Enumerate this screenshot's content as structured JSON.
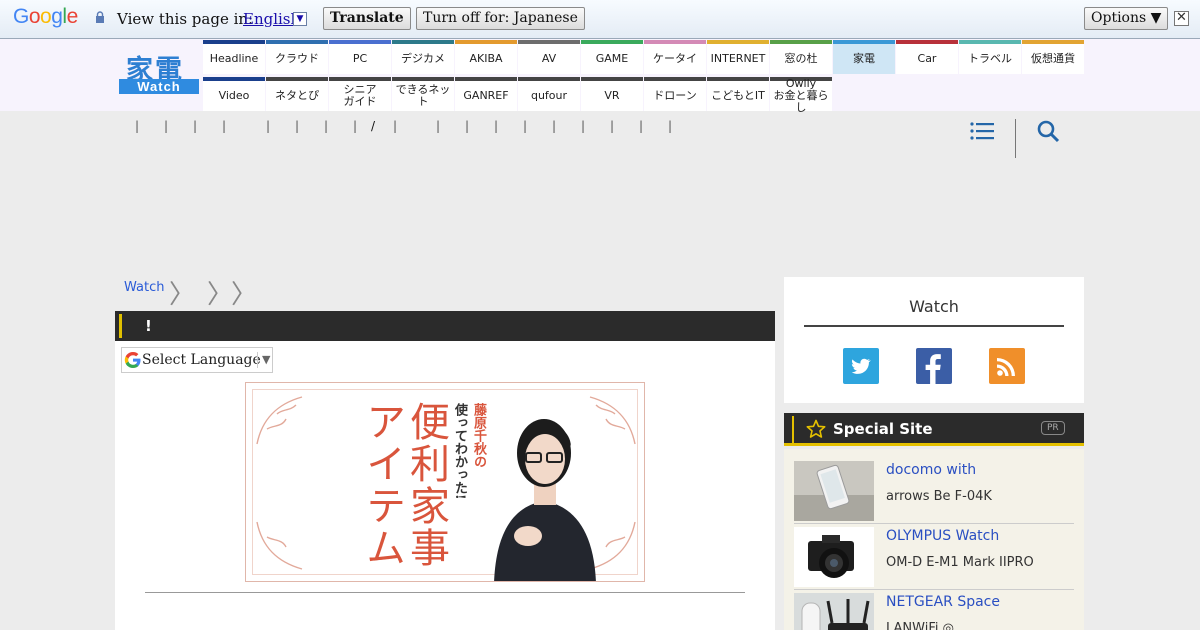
{
  "translate_bar": {
    "logo": "Google",
    "prompt": "View this page in:",
    "language": "English",
    "translate_label": "Translate",
    "turn_off_label": "Turn off for: Japanese",
    "options_label": "Options ▼",
    "close_label": "✕"
  },
  "site": {
    "logo_kanji": "家電",
    "logo_text": "Watch"
  },
  "nav": {
    "row1": [
      {
        "label": "Headline",
        "color": "#1a3f8c"
      },
      {
        "label": "クラウド",
        "color": "#2f6fb0"
      },
      {
        "label": "PC",
        "color": "#4a6fd0"
      },
      {
        "label": "デジカメ",
        "color": "#2d7a8a"
      },
      {
        "label": "AKIBA",
        "color": "#e39a2e"
      },
      {
        "label": "AV",
        "color": "#6d6d6d"
      },
      {
        "label": "GAME",
        "color": "#3aaa5c"
      },
      {
        "label": "ケータイ",
        "color": "#d48ab6"
      },
      {
        "label": "INTERNET",
        "color": "#e0b030"
      },
      {
        "label": "窓の杜",
        "color": "#58a048"
      },
      {
        "label": "家電",
        "color": "#3a98d6"
      },
      {
        "label": "Car",
        "color": "#b8313a"
      },
      {
        "label": "トラベル",
        "color": "#59b8b0"
      },
      {
        "label": "仮想通貨",
        "color": "#e2a432"
      }
    ],
    "row2": [
      {
        "label": "Video",
        "color": "#1a3f8c"
      },
      {
        "label": "ネタとぴ",
        "color": "#444444"
      },
      {
        "label": "シニア\nガイド",
        "color": "#444444"
      },
      {
        "label": "できるネット",
        "color": "#444444"
      },
      {
        "label": "GANREF",
        "color": "#444444"
      },
      {
        "label": "qufour",
        "color": "#444444"
      },
      {
        "label": "VR",
        "color": "#444444"
      },
      {
        "label": "ドローン",
        "color": "#444444"
      },
      {
        "label": "こどもとIT",
        "color": "#444444"
      },
      {
        "label": "Owlly\nお金と暮らし",
        "color": "#444444"
      }
    ]
  },
  "subnav": {
    "separators": [
      "|",
      "|",
      "|",
      "|",
      "|",
      "|",
      "|",
      "|",
      "/",
      "|",
      "|",
      "|",
      "|",
      "|",
      "|",
      "|",
      "|",
      "|",
      "|"
    ]
  },
  "breadcrumb": {
    "first": "Watch",
    "sep": "〉"
  },
  "article": {
    "title": "!",
    "select_language": "Select Language",
    "select_arrow": "▼",
    "banner_big_1": "便利家事",
    "banner_big_2": "アイテム",
    "banner_small_1": "藤原千秋の",
    "banner_small_2": "使ってわかった!"
  },
  "sidebar": {
    "card_title": "Watch",
    "special_title": "Special Site",
    "pr_badge": "PR",
    "items": [
      {
        "title": "docomo with",
        "sub": "arrows Be F-04K"
      },
      {
        "title": "OLYMPUS Watch",
        "sub": "OM-D E-M1 Mark IIPRO"
      },
      {
        "title": "NETGEAR Space",
        "sub": "LANWiFi ◎"
      }
    ]
  },
  "colors": {
    "link": "#2a5bd7",
    "accent_yellow": "#e4c000",
    "dark_bar": "#2b2b2b"
  }
}
